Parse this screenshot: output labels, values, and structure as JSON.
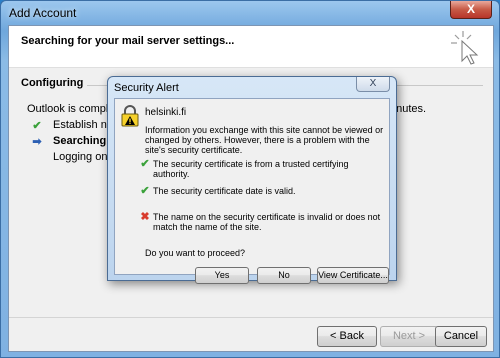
{
  "window": {
    "title": "Add Account",
    "close_label": "X"
  },
  "header": {
    "title": "Searching for your mail server settings...",
    "progress_dots": ". . . . ."
  },
  "section": {
    "title": "Configuring",
    "intro": "Outlook is completing the setup for your account. This might take several minutes.",
    "steps": [
      {
        "state": "done",
        "label": "Establish network connection"
      },
      {
        "state": "current",
        "label": "Searching for your@email.fi server settings"
      },
      {
        "state": "pending",
        "label": "Logging on to the mail server"
      }
    ]
  },
  "footer": {
    "back_label": "< Back",
    "next_label": "Next >",
    "cancel_label": "Cancel"
  },
  "dialog": {
    "title": "Security Alert",
    "close_label": "X",
    "site": "helsinki.fi",
    "info": "Information you exchange with this site cannot be viewed or changed by others. However, there is a problem with the site's security certificate.",
    "items": [
      {
        "status": "ok",
        "text": "The security certificate is from a trusted certifying authority."
      },
      {
        "status": "ok",
        "text": "The security certificate date is valid."
      },
      {
        "status": "error",
        "text": "The name on the security certificate is invalid or does not match the name of the site."
      }
    ],
    "question": "Do you want to proceed?",
    "yes_label": "Yes",
    "no_label": "No",
    "view_cert_label": "View Certificate..."
  },
  "colors": {
    "check": "#3aa13a",
    "error": "#d83b2d",
    "arrow": "#2c5fb3"
  }
}
